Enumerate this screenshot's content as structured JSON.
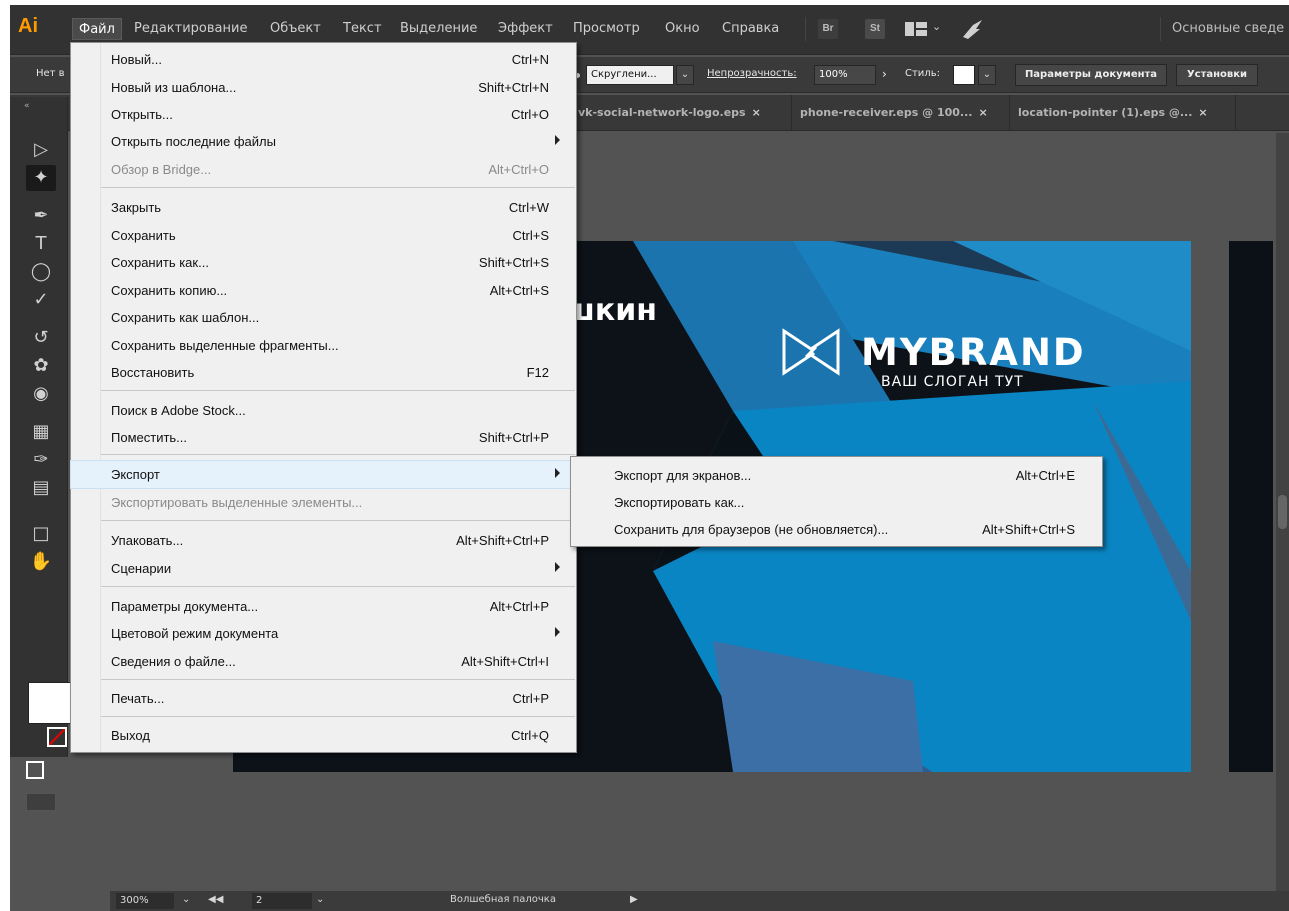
{
  "app": {
    "logo": "Ai",
    "workspace": "Основные сведе"
  },
  "menubar": {
    "items": [
      "Файл",
      "Редактирование",
      "Объект",
      "Текст",
      "Выделение",
      "Эффект",
      "Просмотр",
      "Окно",
      "Справка"
    ],
    "bridge_badge": "Br",
    "stock_badge": "St"
  },
  "controlbar": {
    "no_selection": "Нет в",
    "brush_value": "Скруглени...",
    "opacity_label": "Непрозрачность:",
    "opacity_value": "100%",
    "style_label": "Стиль:",
    "doc_params_button": "Параметры документа",
    "preferences_button": "Установки"
  },
  "tabs": [
    {
      "label": "vk-social-network-logo.eps",
      "close": "×"
    },
    {
      "label": "phone-receiver.eps @ 100...",
      "close": "×"
    },
    {
      "label": "location-pointer (1).eps @...",
      "close": "×"
    }
  ],
  "canvas": {
    "name_fragment": "шкин",
    "brand_name": "MYBRAND",
    "brand_slogan": "ВАШ СЛОГАН ТУТ",
    "colors": {
      "dark": "#0c1218",
      "blue": "#1a85c2",
      "mid_blue": "#2f6da3",
      "light_blue": "#0a90d0"
    }
  },
  "file_menu": {
    "items": [
      {
        "label": "Новый...",
        "shortcut": "Ctrl+N"
      },
      {
        "label": "Новый из шаблона...",
        "shortcut": "Shift+Ctrl+N"
      },
      {
        "label": "Открыть...",
        "shortcut": "Ctrl+O"
      },
      {
        "label": "Открыть последние файлы",
        "shortcut": ""
      },
      {
        "label": "Обзор в Bridge...",
        "shortcut": "Alt+Ctrl+O"
      },
      {
        "label": "Закрыть",
        "shortcut": "Ctrl+W"
      },
      {
        "label": "Сохранить",
        "shortcut": "Ctrl+S"
      },
      {
        "label": "Сохранить как...",
        "shortcut": "Shift+Ctrl+S"
      },
      {
        "label": "Сохранить копию...",
        "shortcut": "Alt+Ctrl+S"
      },
      {
        "label": "Сохранить как шаблон...",
        "shortcut": ""
      },
      {
        "label": "Сохранить выделенные фрагменты...",
        "shortcut": ""
      },
      {
        "label": "Восстановить",
        "shortcut": "F12"
      },
      {
        "label": "Поиск в Adobe Stock...",
        "shortcut": ""
      },
      {
        "label": "Поместить...",
        "shortcut": "Shift+Ctrl+P"
      },
      {
        "label": "Экспорт",
        "shortcut": ""
      },
      {
        "label": "Экспортировать выделенные элементы...",
        "shortcut": ""
      },
      {
        "label": "Упаковать...",
        "shortcut": "Alt+Shift+Ctrl+P"
      },
      {
        "label": "Сценарии",
        "shortcut": ""
      },
      {
        "label": "Параметры документа...",
        "shortcut": "Alt+Ctrl+P"
      },
      {
        "label": "Цветовой режим документа",
        "shortcut": ""
      },
      {
        "label": "Сведения о файле...",
        "shortcut": "Alt+Shift+Ctrl+I"
      },
      {
        "label": "Печать...",
        "shortcut": "Ctrl+P"
      },
      {
        "label": "Выход",
        "shortcut": "Ctrl+Q"
      }
    ]
  },
  "export_menu": {
    "items": [
      {
        "label": "Экспорт для экранов...",
        "shortcut": "Alt+Ctrl+E"
      },
      {
        "label": "Экспортировать как...",
        "shortcut": ""
      },
      {
        "label": "Сохранить для браузеров (не обновляется)...",
        "shortcut": "Alt+Shift+Ctrl+S"
      }
    ]
  },
  "statusbar": {
    "zoom": "300%",
    "artboard_number": "2",
    "tool_name": "Волшебная палочка"
  }
}
